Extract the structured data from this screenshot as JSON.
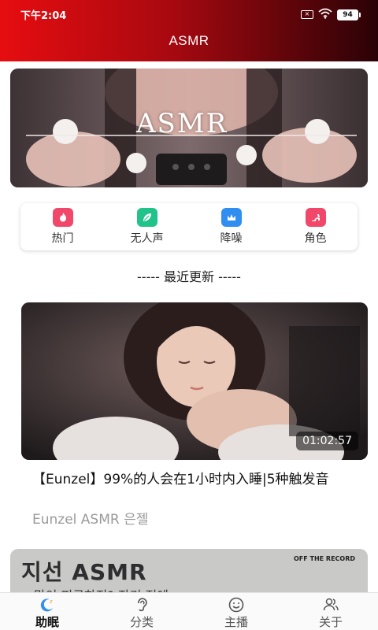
{
  "status_bar": {
    "time": "下午2:04",
    "battery": "94"
  },
  "app": {
    "title": "ASMR"
  },
  "banner": {
    "text": "ASMR"
  },
  "categories": [
    {
      "label": "热门",
      "icon": "flame-icon",
      "color": "#f0476b"
    },
    {
      "label": "无人声",
      "icon": "leaf-icon",
      "color": "#21c38a"
    },
    {
      "label": "降噪",
      "icon": "crown-icon",
      "color": "#2f8ef0"
    },
    {
      "label": "角色",
      "icon": "heel-icon",
      "color": "#f0476b"
    }
  ],
  "section": {
    "title": "-----  最近更新  -----"
  },
  "videos": [
    {
      "duration": "01:02:57",
      "title": "【Eunzel】99%的人会在1小时内入睡|5种触发音",
      "author": "Eunzel ASMR 은젤"
    }
  ],
  "next_card": {
    "title": "지선 ASMR",
    "subtitle": "많이 피곤하지? 자기 전에",
    "logo": "OFF THE RECORD"
  },
  "bottom_nav": [
    {
      "label": "助眠",
      "icon": "moon-icon",
      "active": true
    },
    {
      "label": "分类",
      "icon": "ear-icon",
      "active": false
    },
    {
      "label": "主播",
      "icon": "smile-icon",
      "active": false
    },
    {
      "label": "关于",
      "icon": "people-icon",
      "active": false
    }
  ],
  "colors": {
    "header_start": "#e60d10",
    "header_end": "#2a0206",
    "accent": "#f0476b"
  }
}
